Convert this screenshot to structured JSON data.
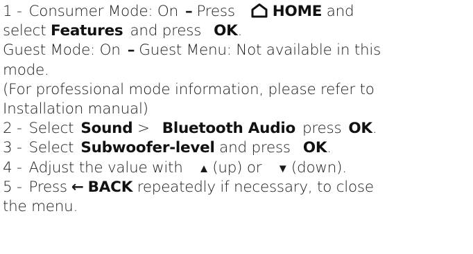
{
  "steps": {
    "s1": {
      "num": "1 -",
      "consumer_mode": "Consumer Mode: On",
      "press": "Press",
      "home_icon": "home-icon",
      "home": "HOME",
      "and": "and",
      "select": "select",
      "features": "Features",
      "and_press": "and press",
      "ok": "OK",
      "period": "."
    },
    "guest": {
      "guest_mode": "Guest Mode: On",
      "guest_menu": "Guest Menu: Not available in this",
      "mode": "mode."
    },
    "pro": {
      "line1": "(For professional mode information, please refer to",
      "line2": "Installation manual)"
    },
    "s2": {
      "num": "2 -",
      "select": "Select",
      "sound": "Sound",
      "gt": ">",
      "bluetooth_audio": "Bluetooth Audio",
      "press": "press",
      "ok": "OK",
      "period": "."
    },
    "s3": {
      "num": "3 -",
      "select": "Select",
      "subwoofer": "Subwoofer-level",
      "and_press": "and press",
      "ok": "OK",
      "period": "."
    },
    "s4": {
      "num": "4 -",
      "text": "Adjust the value with",
      "up_icon": "up-triangle-icon",
      "up": "(up) or",
      "down_icon": "down-triangle-icon",
      "down": "(down)."
    },
    "s5": {
      "num": "5 -",
      "press": "Press",
      "back_icon": "back-arrow-icon",
      "back": "BACK",
      "rest": "repeatedly if necessary, to close",
      "line2": "the menu."
    }
  }
}
